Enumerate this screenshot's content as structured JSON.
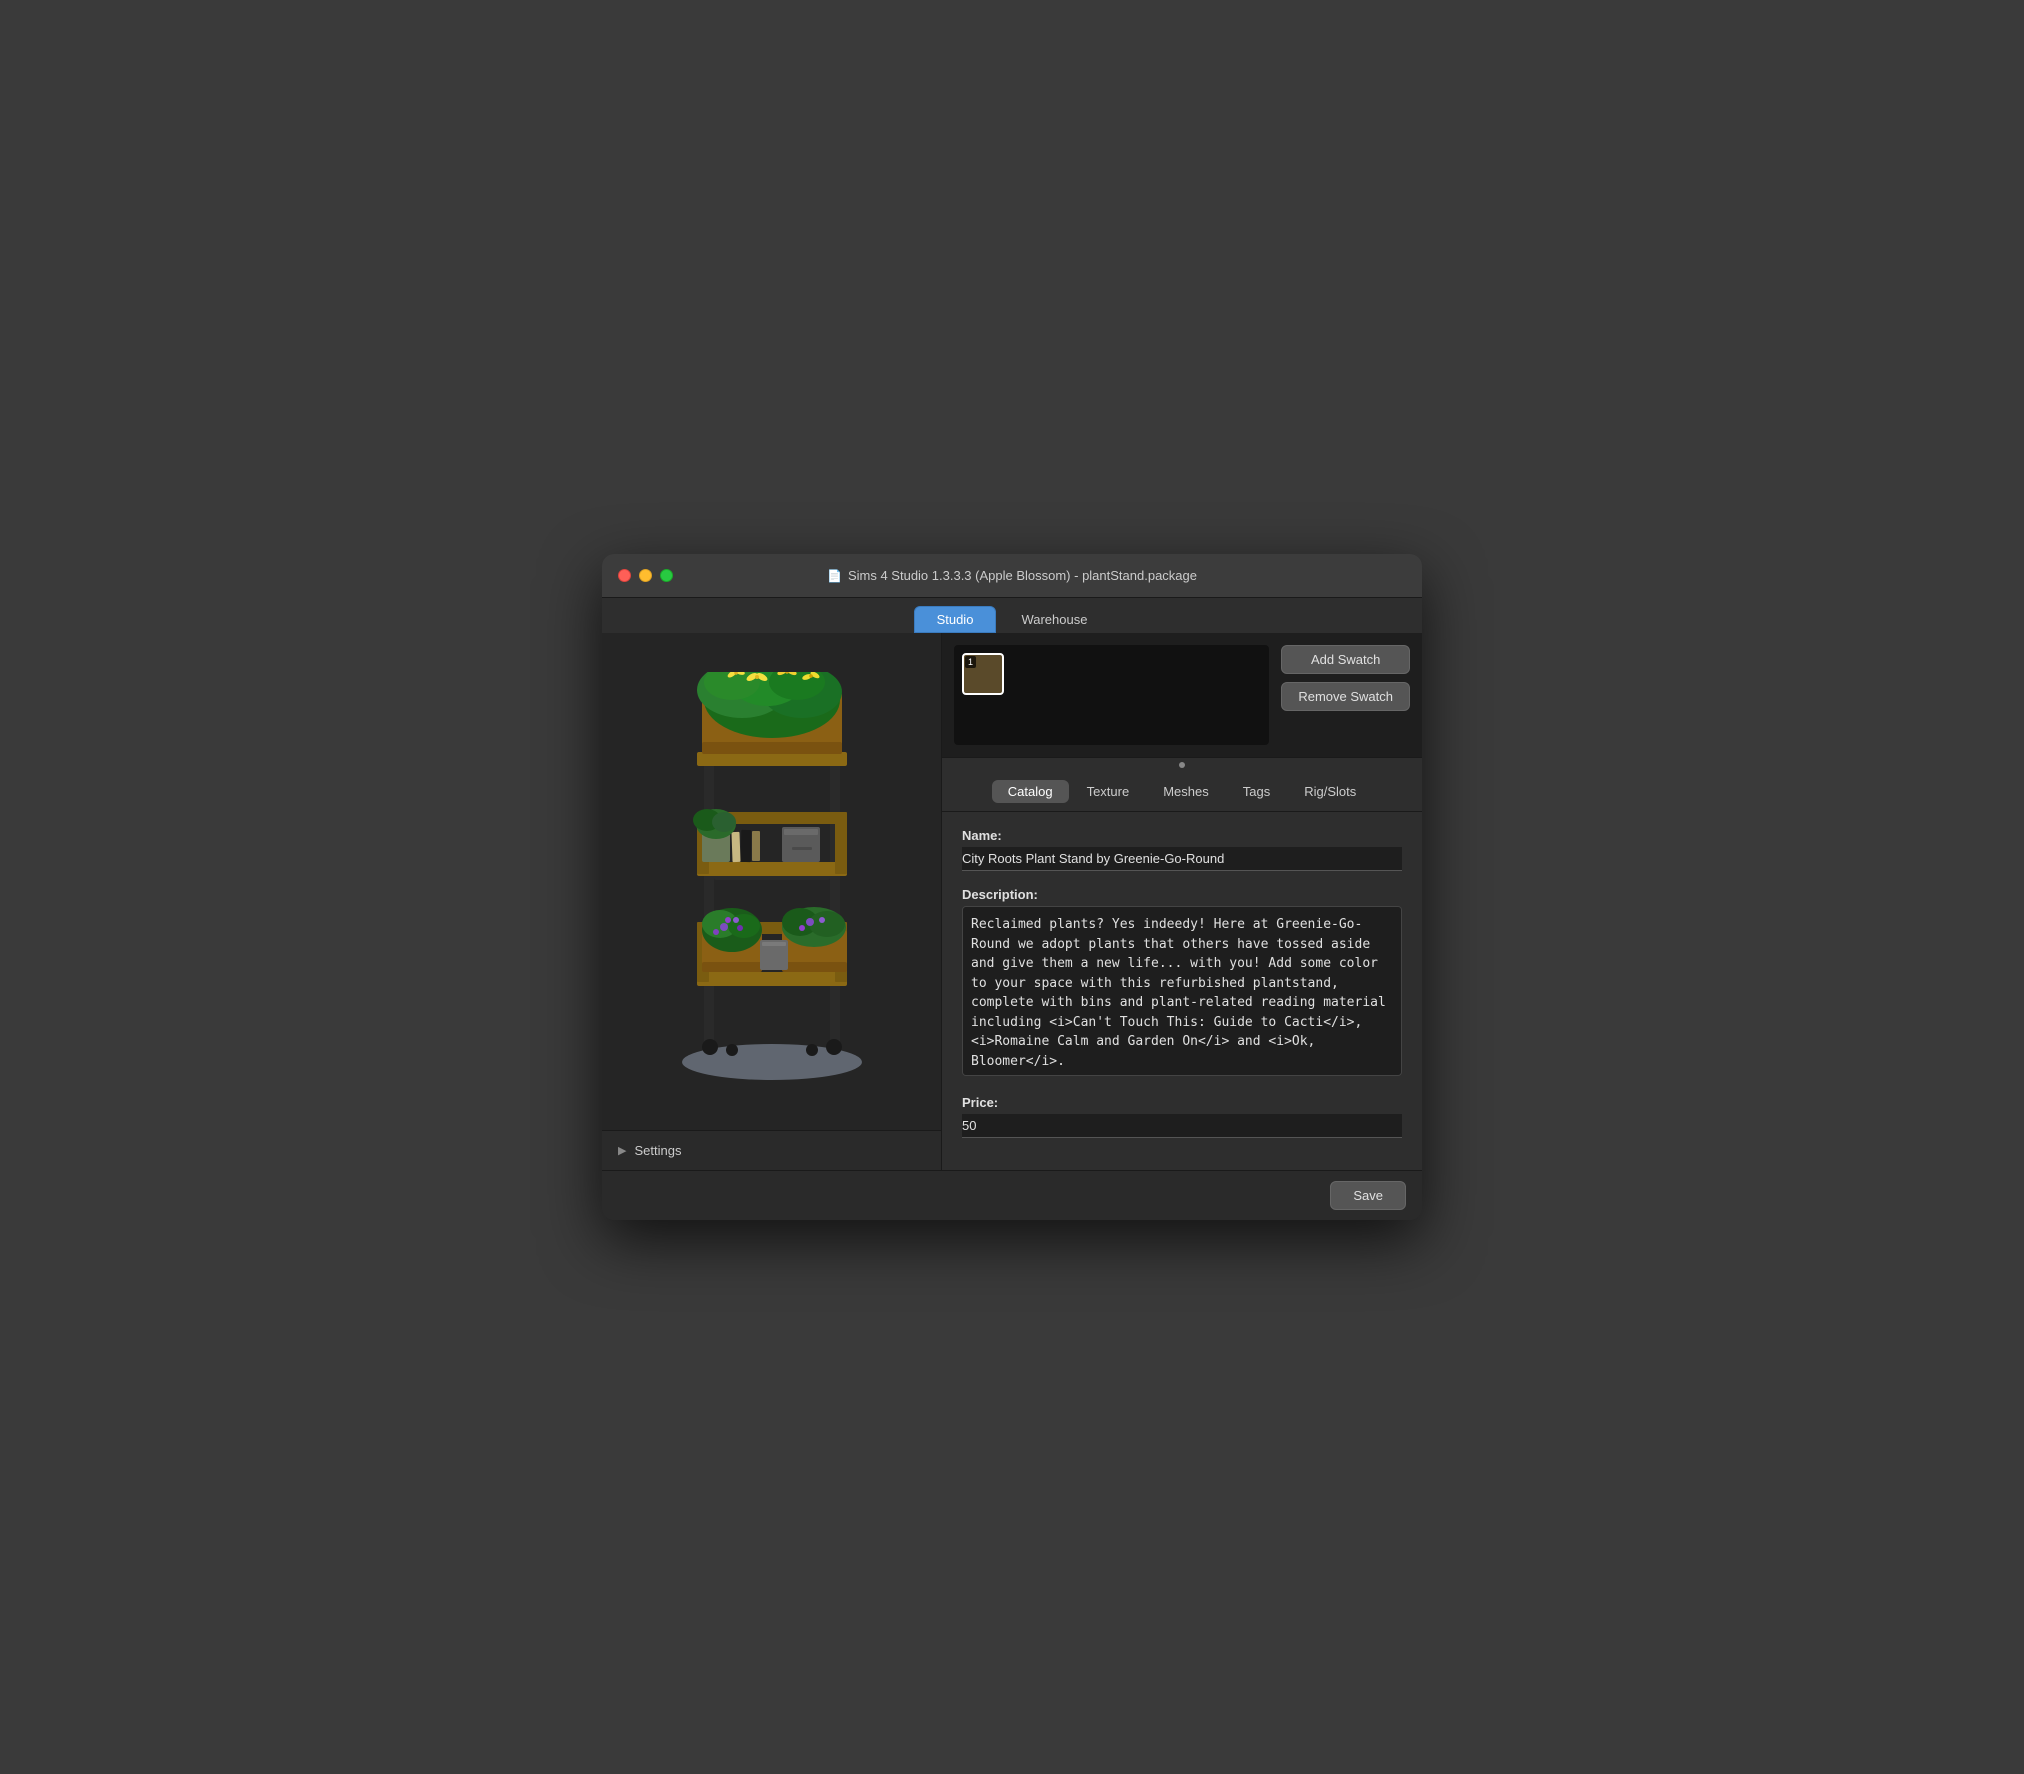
{
  "window": {
    "title": "Sims 4 Studio 1.3.3.3 (Apple Blossom)  - plantStand.package",
    "doc_icon": "📄"
  },
  "tabs": {
    "items": [
      {
        "id": "studio",
        "label": "Studio",
        "active": true
      },
      {
        "id": "warehouse",
        "label": "Warehouse",
        "active": false
      }
    ]
  },
  "swatch": {
    "add_label": "Add Swatch",
    "remove_label": "Remove Swatch",
    "items": [
      {
        "number": "1",
        "selected": true
      }
    ]
  },
  "sub_tabs": {
    "items": [
      {
        "id": "catalog",
        "label": "Catalog",
        "active": true
      },
      {
        "id": "texture",
        "label": "Texture",
        "active": false
      },
      {
        "id": "meshes",
        "label": "Meshes",
        "active": false
      },
      {
        "id": "tags",
        "label": "Tags",
        "active": false
      },
      {
        "id": "rig_slots",
        "label": "Rig/Slots",
        "active": false
      }
    ]
  },
  "catalog": {
    "name_label": "Name:",
    "name_value": "City Roots Plant Stand by Greenie-Go-Round",
    "description_label": "Description:",
    "description_value": "Reclaimed plants? Yes indeedy! Here at Greenie-Go-Round we adopt plants that others have tossed aside and give them a new life... with you! Add some color to your space with this refurbished plantstand, complete with bins and plant-related reading material including <i>Can't Touch This: Guide to Cacti</i>, <i>Romaine Calm and Garden On</i> and <i>Ok, Bloomer</i>.",
    "price_label": "Price:",
    "price_value": "50"
  },
  "settings": {
    "label": "Settings"
  },
  "footer": {
    "save_label": "Save"
  }
}
